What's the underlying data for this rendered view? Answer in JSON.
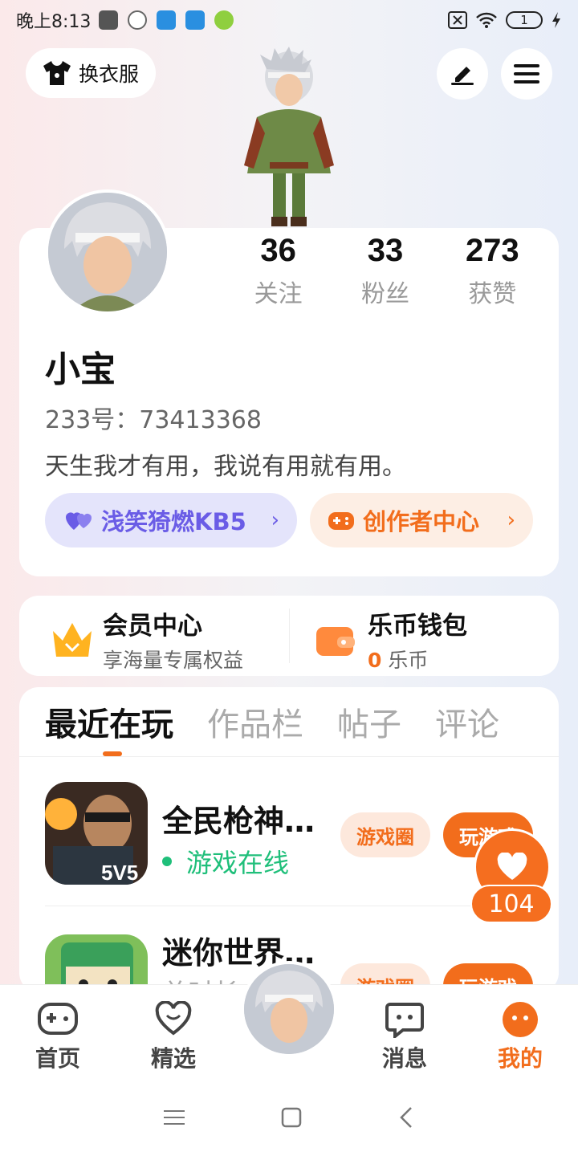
{
  "status_bar": {
    "time": "晚上8:13",
    "battery": "1"
  },
  "header": {
    "change_clothes_label": "换衣服"
  },
  "profile": {
    "stats": [
      {
        "count": "36",
        "label": "关注"
      },
      {
        "count": "33",
        "label": "粉丝"
      },
      {
        "count": "273",
        "label": "获赞"
      }
    ],
    "name": "小宝",
    "id_text": "233号：73413368",
    "bio": "天生我才有用，我说有用就有用。",
    "tag_left": "浅笑猗燃KB5",
    "tag_right": "创作者中心"
  },
  "quick": {
    "vip_title": "会员中心",
    "vip_sub": "享海量专属权益",
    "wallet_title": "乐币钱包",
    "wallet_amount": "0",
    "wallet_unit": "乐币"
  },
  "tabs": [
    "最近在玩",
    "作品栏",
    "帖子",
    "评论"
  ],
  "games": [
    {
      "name": "全民枪神…",
      "status": "游戏在线",
      "btn1": "游戏圈",
      "btn2": "玩游戏"
    },
    {
      "name": "迷你世界…",
      "status": "总时长",
      "btn1": "游戏圈",
      "btn2": "玩游戏"
    }
  ],
  "like_count": "104",
  "nav": {
    "home": "首页",
    "featured": "精选",
    "messages": "消息",
    "mine": "我的"
  },
  "colors": {
    "accent": "#f26d1c",
    "purple": "#6a5ce6",
    "online": "#1fbf7a"
  }
}
